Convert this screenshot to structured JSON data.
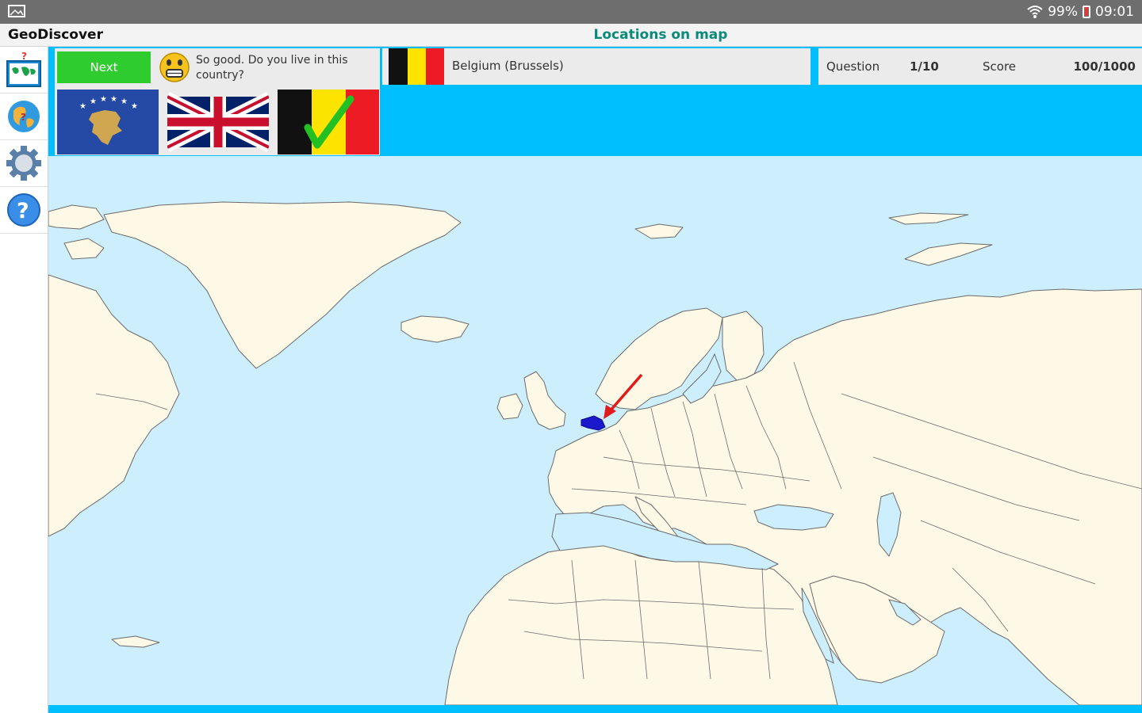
{
  "status_bar": {
    "battery": "99%",
    "time": "09:01"
  },
  "app_bar": {
    "app_name": "GeoDiscover",
    "screen_title": "Locations on map"
  },
  "sidebar": {
    "items": [
      {
        "icon": "map-quiz-icon"
      },
      {
        "icon": "globe-icon"
      },
      {
        "icon": "gear-icon"
      },
      {
        "icon": "help-icon"
      }
    ]
  },
  "quiz": {
    "next_label": "Next",
    "feedback_message": "So good. Do you live in this country?",
    "answer": "Belgium (Brussels)",
    "question_label": "Question",
    "question_value": "1/10",
    "score_label": "Score",
    "score_value": "100/1000",
    "flag_options": [
      "Kosovo",
      "United Kingdom",
      "Belgium"
    ],
    "correct_flag": "Belgium"
  },
  "colors": {
    "accent_cyan": "#00bfff",
    "next_button": "#2ecc2e",
    "title_teal": "#0b8a7a",
    "ocean": "#cdeefd",
    "land": "#fdf9e6",
    "highlight_country": "#1a1acc",
    "arrow": "#e01b1b"
  }
}
